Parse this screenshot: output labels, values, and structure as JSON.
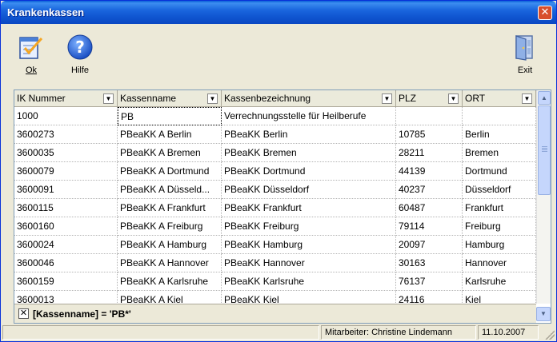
{
  "window": {
    "title": "Krankenkassen",
    "close_glyph": "✕"
  },
  "toolbar": {
    "ok": {
      "label": "Ok",
      "icon": "checklist-icon"
    },
    "help": {
      "label": "Hilfe",
      "icon": "help-icon"
    },
    "exit": {
      "label": "Exit",
      "icon": "exit-door-icon"
    }
  },
  "grid": {
    "columns": [
      "IK Nummer",
      "Kassenname",
      "Kassenbezeichnung",
      "PLZ",
      "ORT"
    ],
    "rows": [
      [
        "1000",
        "PB",
        "Verrechnungsstelle für Heilberufe",
        "",
        ""
      ],
      [
        "3600273",
        "PBeaKK A Berlin",
        "PBeaKK Berlin",
        "10785",
        "Berlin"
      ],
      [
        "3600035",
        "PBeaKK A Bremen",
        "PBeaKK Bremen",
        "28211",
        "Bremen"
      ],
      [
        "3600079",
        "PBeaKK A Dortmund",
        "PBeaKK Dortmund",
        "44139",
        "Dortmund"
      ],
      [
        "3600091",
        "PBeaKK A Düsseld...",
        "PBeaKK Düsseldorf",
        "40237",
        "Düsseldorf"
      ],
      [
        "3600115",
        "PBeaKK A Frankfurt",
        "PBeaKK Frankfurt",
        "60487",
        "Frankfurt"
      ],
      [
        "3600160",
        "PBeaKK A Freiburg",
        "PBeaKK Freiburg",
        "79114",
        "Freiburg"
      ],
      [
        "3600024",
        "PBeaKK A Hamburg",
        "PBeaKK Hamburg",
        "20097",
        "Hamburg"
      ],
      [
        "3600046",
        "PBeaKK A Hannover",
        "PBeaKK Hannover",
        "30163",
        "Hannover"
      ],
      [
        "3600159",
        "PBeaKK A Karlsruhe",
        "PBeaKK Karlsruhe",
        "76137",
        "Karlsruhe"
      ],
      [
        "3600013",
        "PBeaKK A Kiel",
        "PBeaKK Kiel",
        "24116",
        "Kiel"
      ]
    ],
    "filter": {
      "clear_glyph": "✕",
      "text": "[Kassenname] = 'PB*'"
    }
  },
  "statusbar": {
    "panel1": "",
    "employee": "Mitarbeiter:  Christine Lindemann",
    "date": "11.10.2007"
  },
  "colors": {
    "titlebar": "#0a5fd8",
    "close": "#d84e2c",
    "window_bg": "#ece9d8"
  }
}
